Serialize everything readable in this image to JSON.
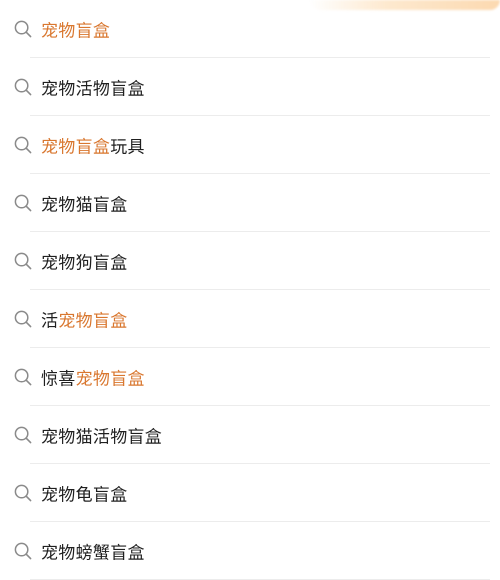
{
  "accent_color": "#d9772f",
  "icon": "search-icon",
  "suggestions": [
    {
      "segments": [
        {
          "text": "宠物盲盒",
          "hl": true
        }
      ]
    },
    {
      "segments": [
        {
          "text": "宠物活物盲盒",
          "hl": false
        }
      ]
    },
    {
      "segments": [
        {
          "text": "宠物盲盒",
          "hl": true
        },
        {
          "text": "玩具",
          "hl": false
        }
      ]
    },
    {
      "segments": [
        {
          "text": "宠物猫盲盒",
          "hl": false
        }
      ]
    },
    {
      "segments": [
        {
          "text": "宠物狗盲盒",
          "hl": false
        }
      ]
    },
    {
      "segments": [
        {
          "text": "活",
          "hl": false
        },
        {
          "text": "宠物盲盒",
          "hl": true
        }
      ]
    },
    {
      "segments": [
        {
          "text": "惊喜",
          "hl": false
        },
        {
          "text": "宠物盲盒",
          "hl": true
        }
      ]
    },
    {
      "segments": [
        {
          "text": "宠物猫活物盲盒",
          "hl": false
        }
      ]
    },
    {
      "segments": [
        {
          "text": "宠物龟盲盒",
          "hl": false
        }
      ]
    },
    {
      "segments": [
        {
          "text": "宠物螃蟹盲盒",
          "hl": false
        }
      ]
    }
  ]
}
